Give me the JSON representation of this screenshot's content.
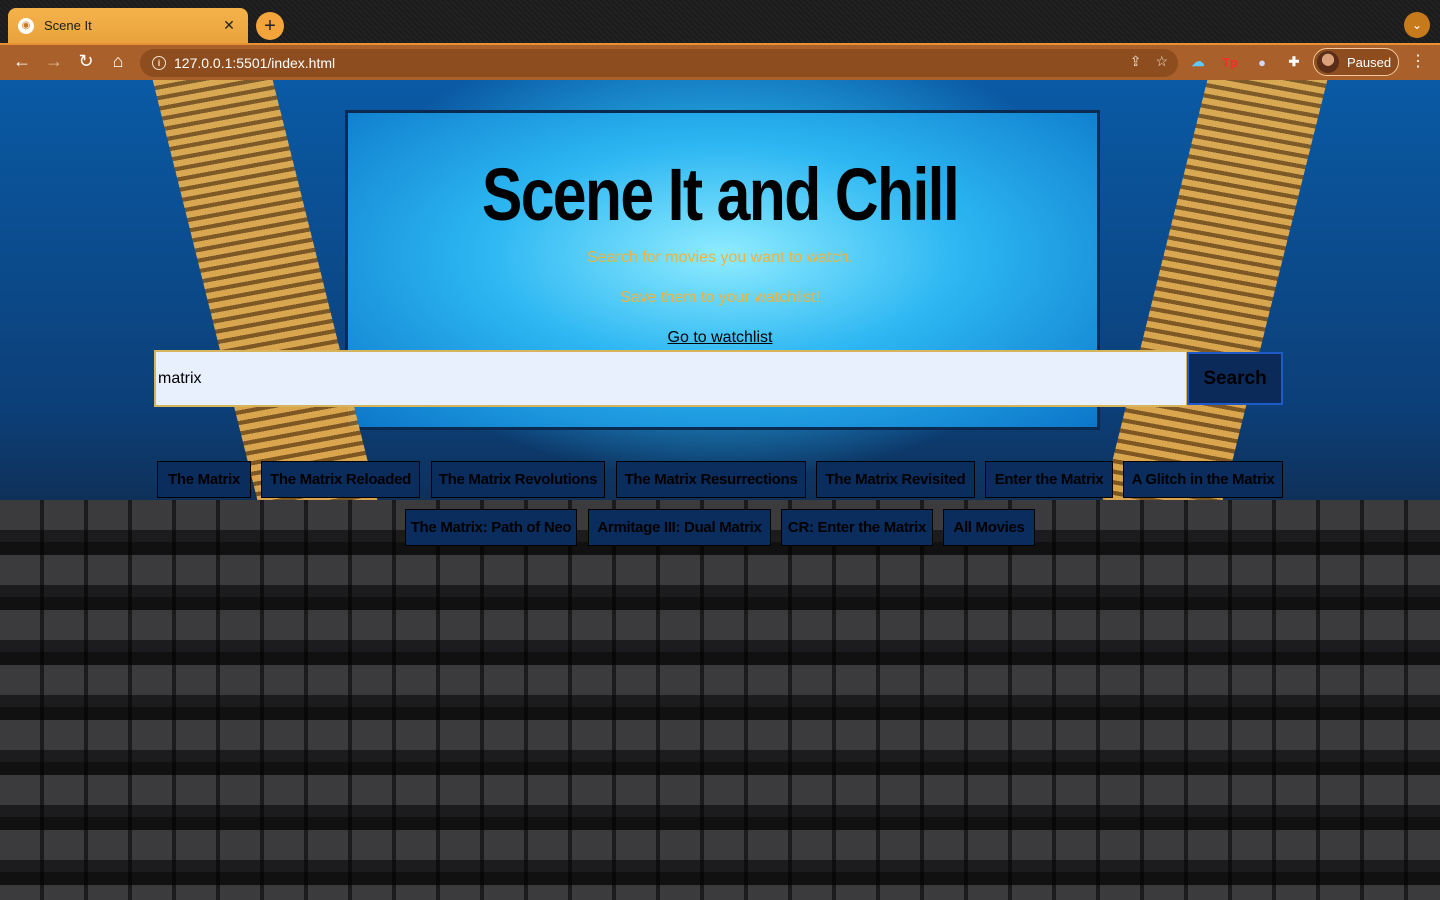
{
  "browser": {
    "tab_title": "Scene It",
    "url": "127.0.0.1:5501/index.html",
    "profile_label": "Paused"
  },
  "page": {
    "heading": "Scene It and Chill",
    "subtitle_1": "Search for movies you want to watch.",
    "subtitle_2": "Save them to your watchlist!",
    "watchlist_link": "Go to watchlist",
    "search": {
      "value": "matrix",
      "button_label": "Search"
    },
    "results": [
      "The Matrix",
      "The Matrix Reloaded",
      "The Matrix Revolutions",
      "The Matrix Resurrections",
      "The Matrix Revisited",
      "Enter the Matrix",
      "A Glitch in the Matrix",
      "The Matrix: Path of Neo",
      "Armitage III: Dual Matrix",
      "CR: Enter the Matrix",
      "All Movies"
    ]
  },
  "colors": {
    "accent_text": "#f0b23a",
    "chip_bg": "#0a2d5e",
    "input_bg": "#e8effd",
    "toolbar": "#a9602a"
  }
}
